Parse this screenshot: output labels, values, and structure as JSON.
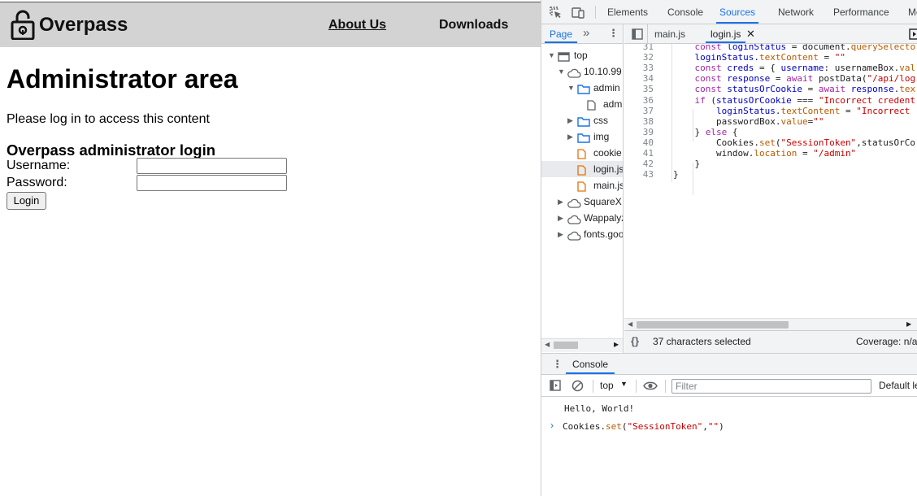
{
  "site": {
    "brand": "Overpass",
    "nav": {
      "about": "About Us",
      "downloads": "Downloads"
    },
    "title": "Administrator area",
    "info": "Please log in to access this content",
    "login_heading": "Overpass administrator login",
    "username_label": "Username:",
    "password_label": "Password:",
    "username_value": "",
    "password_value": "",
    "login_button": "Login"
  },
  "devtools": {
    "tabs": [
      "Elements",
      "Console",
      "Sources",
      "Network",
      "Performance",
      "Me"
    ],
    "active_tab": "Sources",
    "navigator": {
      "tab_label": "Page",
      "tree": [
        {
          "label": "top",
          "type": "frame",
          "expanded": true
        },
        {
          "label": "10.10.99",
          "type": "cloud",
          "expanded": true
        },
        {
          "label": "admin",
          "type": "folder",
          "expanded": true
        },
        {
          "label": "adm",
          "type": "file"
        },
        {
          "label": "css",
          "type": "folder",
          "expanded": false
        },
        {
          "label": "img",
          "type": "folder",
          "expanded": false
        },
        {
          "label": "cookie",
          "type": "jsfile"
        },
        {
          "label": "login.js",
          "type": "jsfile",
          "selected": true
        },
        {
          "label": "main.js",
          "type": "jsfile"
        },
        {
          "label": "SquareX",
          "type": "cloud",
          "expanded": false
        },
        {
          "label": "Wappalyz",
          "type": "cloud",
          "expanded": false
        },
        {
          "label": "fonts.goo",
          "type": "cloud",
          "expanded": false
        }
      ]
    },
    "editor": {
      "tabs": [
        {
          "label": "main.js"
        },
        {
          "label": "login.js",
          "active": true
        }
      ],
      "lines": [
        {
          "n": "31",
          "code": "    const loginStatus = document.querySelecto"
        },
        {
          "n": "32",
          "code": "    loginStatus.textContent = \"\""
        },
        {
          "n": "33",
          "code": "    const creds = { username: usernameBox.val"
        },
        {
          "n": "34",
          "code": "    const response = await postData(\"/api/log"
        },
        {
          "n": "35",
          "code": "    const statusOrCookie = await response.tex"
        },
        {
          "n": "36",
          "code": "    if (statusOrCookie === \"Incorrect credent"
        },
        {
          "n": "37",
          "code": "        loginStatus.textContent = \"Incorrect "
        },
        {
          "n": "38",
          "code": "        passwordBox.value=\"\""
        },
        {
          "n": "39",
          "code": "    } else {"
        },
        {
          "n": "40",
          "code": "        Cookies.set(\"SessionToken\",statusOrCo"
        },
        {
          "n": "41",
          "code": "        window.location = \"/admin\""
        },
        {
          "n": "42",
          "code": "    }"
        },
        {
          "n": "43",
          "code": "}"
        }
      ],
      "status_left": "37 characters selected",
      "status_right": "Coverage: n/a"
    },
    "drawer": {
      "tab": "Console",
      "context": "top",
      "filter_placeholder": "Filter",
      "levels": "Default le",
      "output": "Hello, World!",
      "input": "Cookies.set(\"SessionToken\",\"\")"
    }
  }
}
